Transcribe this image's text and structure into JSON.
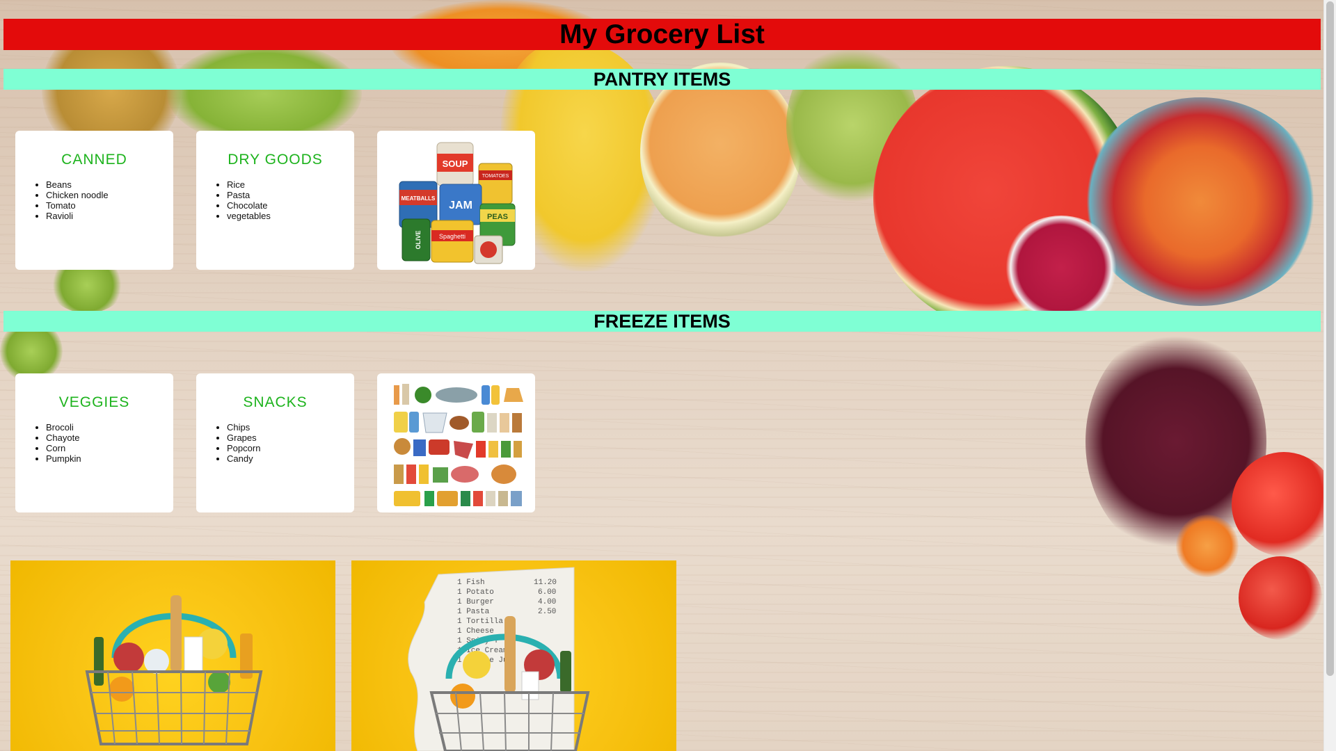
{
  "header": {
    "title": "My Grocery List"
  },
  "sections": {
    "pantry": {
      "title": "PANTRY ITEMS",
      "cards": [
        {
          "title": "CANNED",
          "items": [
            "Beans",
            "Chicken noodle",
            "Tomato",
            "Ravioli"
          ]
        },
        {
          "title": "DRY GOODS",
          "items": [
            "Rice",
            "Pasta",
            "Chocolate",
            "vegetables"
          ]
        }
      ],
      "image": {
        "icon": "canned-goods-illustration",
        "labels": [
          "SOUP",
          "TOMATOES",
          "MEATBALLS",
          "JAM",
          "PEAS",
          "OLIVE",
          "Spaghetti"
        ]
      }
    },
    "freeze": {
      "title": "FREEZE ITEMS",
      "cards": [
        {
          "title": "VEGGIES",
          "items": [
            "Brocoli",
            "Chayote",
            "Corn",
            "Pumpkin"
          ]
        },
        {
          "title": "SNACKS",
          "items": [
            "Chips",
            "Grapes",
            "Popcorn",
            "Candy"
          ]
        }
      ],
      "image": {
        "icon": "frozen-foods-grid-illustration"
      }
    }
  },
  "bottom_images": {
    "basket_1": {
      "icon": "grocery-basket-photo"
    },
    "basket_2": {
      "icon": "grocery-basket-receipt-photo",
      "receipt_lines": [
        "1 Fish",
        "1 Potato",
        "1 Burger",
        "1 Pasta",
        "1 Tortilla",
        "1 Cheese",
        "1 Spicy T",
        "1 Ice Cream",
        "1 Orange Ju"
      ],
      "receipt_prices": [
        "11.20",
        "6.00",
        "4.00",
        "2.50"
      ]
    }
  },
  "colors": {
    "title_bar": "#e30b0b",
    "section_bar": "#7fffd4",
    "card_title": "#1db31d",
    "card_bg": "#ffffff",
    "basket_bg": "#f8c212"
  }
}
